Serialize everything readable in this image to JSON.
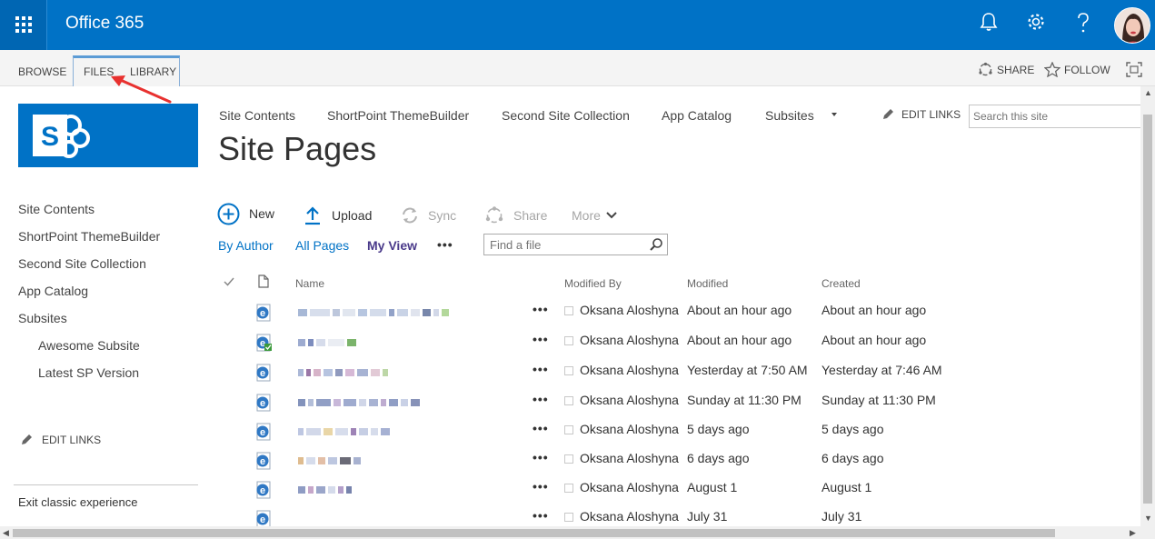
{
  "suitebar": {
    "brand": "Office 365",
    "icons": [
      "app-launcher-icon",
      "bell-icon",
      "gear-icon",
      "help-icon",
      "avatar"
    ]
  },
  "ribbon": {
    "tabs": [
      "BROWSE",
      "FILES",
      "LIBRARY"
    ],
    "share": "SHARE",
    "follow": "FOLLOW"
  },
  "left_nav": {
    "items": [
      "Site Contents",
      "ShortPoint ThemeBuilder",
      "Second Site Collection",
      "App Catalog",
      "Subsites"
    ],
    "subitems": [
      "Awesome Subsite",
      "Latest SP Version"
    ],
    "edit_links": "EDIT LINKS",
    "exit": "Exit classic experience"
  },
  "top_nav": {
    "items": [
      "Site Contents",
      "ShortPoint ThemeBuilder",
      "Second Site Collection",
      "App Catalog",
      "Subsites"
    ],
    "edit_links": "EDIT LINKS",
    "search_placeholder": "Search this site"
  },
  "page_title": "Site Pages",
  "commands": {
    "new": "New",
    "upload": "Upload",
    "sync": "Sync",
    "share": "Share",
    "more": "More"
  },
  "views": {
    "by_author": "By Author",
    "all_pages": "All Pages",
    "my_view": "My View",
    "ellipsis": "•••",
    "find_placeholder": "Find a file"
  },
  "table": {
    "headers": {
      "name": "Name",
      "modified_by": "Modified By",
      "modified": "Modified",
      "created": "Created"
    },
    "rows": [
      {
        "modified_by": "Oksana Aloshyna",
        "modified": "About an hour ago",
        "created": "About an hour ago"
      },
      {
        "modified_by": "Oksana Aloshyna",
        "modified": "About an hour ago",
        "created": "About an hour ago"
      },
      {
        "modified_by": "Oksana Aloshyna",
        "modified": "Yesterday at 7:50 AM",
        "created": "Yesterday at 7:46 AM"
      },
      {
        "modified_by": "Oksana Aloshyna",
        "modified": "Sunday at 11:30 PM",
        "created": "Sunday at 11:30 PM"
      },
      {
        "modified_by": "Oksana Aloshyna",
        "modified": "5 days ago",
        "created": "5 days ago"
      },
      {
        "modified_by": "Oksana Aloshyna",
        "modified": "6 days ago",
        "created": "6 days ago"
      },
      {
        "modified_by": "Oksana Aloshyna",
        "modified": "August 1",
        "created": "August 1"
      },
      {
        "modified_by": "Oksana Aloshyna",
        "modified": "July 31",
        "created": "July 31"
      }
    ]
  },
  "colors": {
    "suite_blue": "#0072c6",
    "link_blue": "#0072c6",
    "annotation_red": "#e8312f"
  }
}
